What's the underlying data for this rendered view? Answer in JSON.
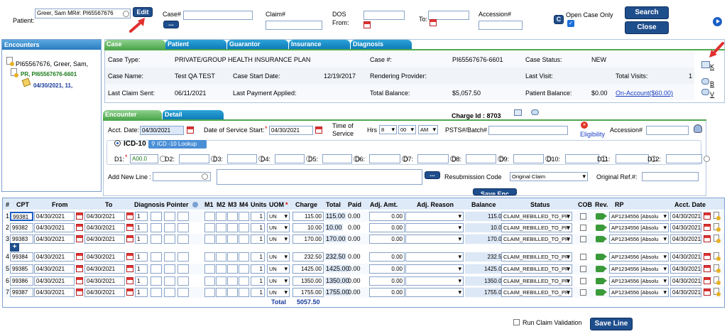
{
  "header": {
    "patient_label": "Patient:",
    "patient_value": "Greer, Sam  MR#:  PI65567676",
    "edit_label": "Edit",
    "case_label": "Case#",
    "case_btn": "...",
    "claim_label": "Claim#",
    "dos_label": "DOS",
    "from_label": "From:",
    "to_label": "To:",
    "accession_label": "Accession#",
    "c_btn": "C",
    "open_case_only": "Open Case Only",
    "search_label": "Search",
    "close_label": "Close"
  },
  "encounters": {
    "title": "Encounters",
    "patient": "PI65567676, Greer, Sam,",
    "case": "PR, PI65567676-6601",
    "date": "04/30/2021, 11,"
  },
  "case_tabs": [
    "Case",
    "Patient",
    "Guarantor",
    "Insurance",
    "Diagnosis"
  ],
  "case_info": {
    "case_type_label": "Case Type:",
    "case_type": "PRIVATE/GROUP HEALTH INSURANCE PLAN",
    "case_no_label": "Case #:",
    "case_no": "PI65567676-6601",
    "case_status_label": "Case Status:",
    "case_status": "NEW",
    "case_name_label": "Case Name:",
    "case_name": "Test QA TEST",
    "case_start_label": "Case Start Date:",
    "case_start": "12/19/2017",
    "rendering_label": "Rendering Provider:",
    "last_visit_label": "Last Visit:",
    "total_visits_label": "Total Visits:",
    "total_visits": "1",
    "last_claim_label": "Last Claim Sent:",
    "last_claim": "06/11/2021",
    "last_payment_label": "Last Payment Applied:",
    "total_balance_label": "Total Balance:",
    "total_balance": "$5,057.50",
    "patient_balance_label": "Patient Balance:",
    "patient_balance": "$0.00",
    "on_account": "On-Account($60.00)",
    "side_k": "K",
    "side_b": "B",
    "side_v": "V"
  },
  "enc_tabs": [
    "Encounter",
    "Detail"
  ],
  "charge_id": "Charge Id : 8703",
  "encounter": {
    "acct_date_label": "Acct. Date:",
    "acct_date": "04/30/2021",
    "dos_start_label": "Date of Service Start:",
    "dos_start": "04/30/2021",
    "time_label": "Time of Service",
    "hrs_label": "Hrs",
    "hrs": "8",
    "mins": "00",
    "ampm": "AM",
    "psts_label": "PSTS#/Batch#",
    "eligibility": "Eligibility",
    "accession_label": "Accession#",
    "icd_label": "ICD-10",
    "icd_lookup": "ICD -10 Lookup",
    "d_labels": [
      "D1:",
      "D2:",
      "D3:",
      "D4:",
      "D5:",
      "D6:",
      "D7:",
      "D8:",
      "D9:",
      "D10:",
      "D11:",
      "D12:"
    ],
    "d1_value": "A00.0",
    "add_line_label": "Add New Line :",
    "resub_label": "Resubmission Code",
    "resub_value": "Original Claim",
    "orig_ref_label": "Original Ref.#:",
    "save_enc": "Save Enc"
  },
  "grid": {
    "headers": [
      "#",
      "CPT",
      "From",
      "To",
      "Diagnosis Pointer",
      "M1",
      "M2",
      "M3",
      "M4",
      "Units",
      "UOM",
      "Charge",
      "Total",
      "Paid",
      "Adj. Amt.",
      "Adj. Reason",
      "Balance",
      "Status",
      "COB",
      "Rev.",
      "RP",
      "Acct. Date"
    ],
    "rows": [
      {
        "n": "1",
        "cpt": "99381",
        "from": "04/30/2021",
        "to": "04/30/2021",
        "dx": "1",
        "units": "1",
        "uom": "UN",
        "charge": "115.00",
        "total": "115.00",
        "paid": "0.00",
        "adj": "0.00",
        "balance": "115.00",
        "status": "CLAIM_REBILLED_TO_PR",
        "rp": "AP1234556 [Absolu",
        "acct": "04/30/2021"
      },
      {
        "n": "2",
        "cpt": "99382",
        "from": "04/30/2021",
        "to": "04/30/2021",
        "dx": "1",
        "units": "1",
        "uom": "UN",
        "charge": "10.00",
        "total": "10.00",
        "paid": "0.00",
        "adj": "0.00",
        "balance": "10.00",
        "status": "CLAIM_REBILLED_TO_PR",
        "rp": "AP1234556 [Absolu",
        "acct": "04/30/2021"
      },
      {
        "n": "3",
        "cpt": "99383",
        "from": "04/30/2021",
        "to": "04/30/2021",
        "dx": "1",
        "units": "1",
        "uom": "UN",
        "charge": "170.00",
        "total": "170.00",
        "paid": "0.00",
        "adj": "0.00",
        "balance": "170.00",
        "status": "CLAIM_REBILLED_TO_PR",
        "rp": "AP1234556 [Absolu",
        "acct": "04/30/2021"
      },
      {
        "n": "4",
        "cpt": "99384",
        "from": "04/30/2021",
        "to": "04/30/2021",
        "dx": "1",
        "units": "1",
        "uom": "UN",
        "charge": "232.50",
        "total": "232.50",
        "paid": "0.00",
        "adj": "0.00",
        "balance": "232.50",
        "status": "CLAIM_REBILLED_TO_PR",
        "rp": "AP1234556 [Absolu",
        "acct": "04/30/2021"
      },
      {
        "n": "5",
        "cpt": "99385",
        "from": "04/30/2021",
        "to": "04/30/2021",
        "dx": "1",
        "units": "1",
        "uom": "UN",
        "charge": "1425.00",
        "total": "1425.00",
        "paid": "0.00",
        "adj": "0.00",
        "balance": "1425.00",
        "status": "CLAIM_REBILLED_TO_PR",
        "rp": "AP1234556 [Absolu",
        "acct": "04/30/2021"
      },
      {
        "n": "6",
        "cpt": "99386",
        "from": "04/30/2021",
        "to": "04/30/2021",
        "dx": "1",
        "units": "1",
        "uom": "UN",
        "charge": "1350.00",
        "total": "1350.00",
        "paid": "0.00",
        "adj": "0.00",
        "balance": "1350.00",
        "status": "CLAIM_REBILLED_TO_PR",
        "rp": "AP1234556 [Absolu",
        "acct": "04/30/2021"
      },
      {
        "n": "7",
        "cpt": "99387",
        "from": "04/30/2021",
        "to": "04/30/2021",
        "dx": "1",
        "units": "1",
        "uom": "UN",
        "charge": "1755.00",
        "total": "1755.00",
        "paid": "0.00",
        "adj": "0.00",
        "balance": "1755.00",
        "status": "CLAIM_REBILLED_TO_PR",
        "rp": "AP1234556 [Absolu",
        "acct": "04/30/2021"
      }
    ],
    "total_label": "Total",
    "total_value": "5057.50"
  },
  "footer": {
    "run_validation": "Run Claim Validation",
    "save_line": "Save Line"
  },
  "colors": {
    "accent": "#1f4e8c",
    "tab_blue": "#0f7bb8",
    "tab_green": "#4fa84f",
    "grid_bg": "#dde8f6"
  }
}
